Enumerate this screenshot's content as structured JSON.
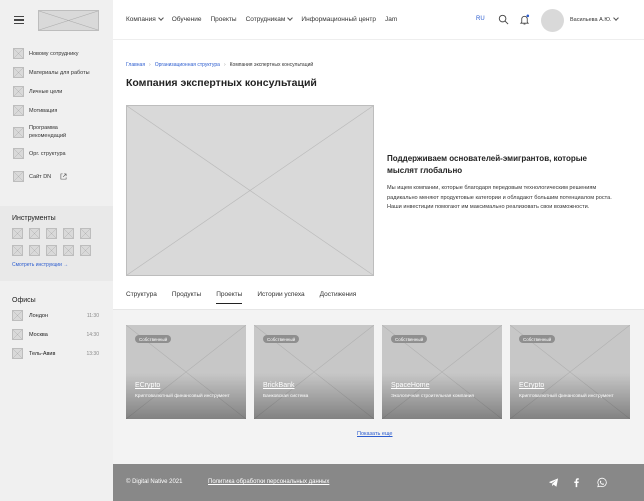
{
  "header": {
    "menu": [
      {
        "label": "Компания",
        "has_dropdown": true
      },
      {
        "label": "Обучение",
        "has_dropdown": false
      },
      {
        "label": "Проекты",
        "has_dropdown": false
      },
      {
        "label": "Сотрудникам",
        "has_dropdown": true
      },
      {
        "label": "Информационный центр",
        "has_dropdown": false
      },
      {
        "label": "Jam",
        "has_dropdown": false
      }
    ],
    "lang": "RU",
    "icons": [
      "search-icon",
      "bell-icon"
    ],
    "user_name": "Васильева А.Ю."
  },
  "sidebar": {
    "items": [
      {
        "label": "Новому сотруднику"
      },
      {
        "label": "Материалы для работы"
      },
      {
        "label": "Личные цели"
      },
      {
        "label": "Мотивация"
      },
      {
        "label": "Программа рекомендаций"
      },
      {
        "label": "Орг. структура"
      },
      {
        "label": "Сайт DN",
        "icon": "external-link-icon"
      }
    ],
    "tools": {
      "title": "Инструменты",
      "link": "Смотреть инструкции →"
    },
    "offices": {
      "title": "Офисы",
      "list": [
        {
          "name": "Лондон",
          "time": "11:30"
        },
        {
          "name": "Москва",
          "time": "14:30"
        },
        {
          "name": "Тель-Авив",
          "time": "13:30"
        }
      ]
    }
  },
  "breadcrumb": {
    "items": [
      "Главная",
      "Организационная структура"
    ],
    "current": "Компания экспертных консультаций"
  },
  "page_title": "Компания экспертных консультаций",
  "hero": {
    "heading": "Поддерживаем основателей-эмигрантов, которые мыслят глобально",
    "text": "Мы ищем компании, которые благодаря передовым технологическим решениям радикально меняют продуктовые категории и обладают большим потенциалом роста. Наши инвестиции помогают им максимально реализовать свои возможности."
  },
  "tabs": [
    {
      "label": "Структура",
      "active": false
    },
    {
      "label": "Продукты",
      "active": false
    },
    {
      "label": "Проекты",
      "active": true
    },
    {
      "label": "Истории успеха",
      "active": false
    },
    {
      "label": "Достижения",
      "active": false
    }
  ],
  "cards": [
    {
      "badge": "Собственный",
      "name": "ECrypto",
      "desc": "Криптовалютный финансовый инструмент"
    },
    {
      "badge": "Собственный",
      "name": "BrickBank",
      "desc": "Банковская система"
    },
    {
      "badge": "Собственный",
      "name": "SpaceHome",
      "desc": "Экологичная строительная компания"
    },
    {
      "badge": "Собственный",
      "name": "ECrypto",
      "desc": "Криптовалютный финансовый инструмент"
    }
  ],
  "show_more": "Показать еще",
  "footer": {
    "copyright": "© Digital Native 2021",
    "policy": "Политика обработки персональных данных",
    "icons": [
      "telegram-icon",
      "facebook-icon",
      "whatsapp-icon"
    ]
  },
  "colors": {
    "accent": "#2b5ccf",
    "footer_bg": "#888888",
    "sidebar_bg": "#f0f0f0"
  }
}
